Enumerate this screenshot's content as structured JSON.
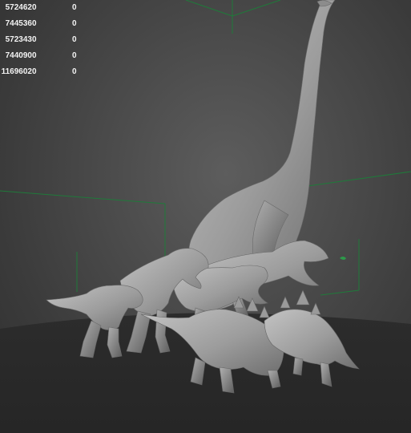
{
  "viewport": {
    "label": "3D perspective viewport",
    "stats": [
      [
        "572462",
        "0",
        "0"
      ],
      [
        "744536",
        "0",
        "0"
      ],
      [
        "572343",
        "0",
        "0"
      ],
      [
        "744090",
        "0",
        "0"
      ],
      [
        "1169602",
        "0",
        "0"
      ]
    ]
  },
  "scene": {
    "models": [
      {
        "name": "brachiosaurus-model"
      },
      {
        "name": "tyrannosaurus-model"
      },
      {
        "name": "carnotaurus-model"
      },
      {
        "name": "raptor-model"
      },
      {
        "name": "stegosaurus-model"
      }
    ]
  },
  "colors": {
    "background": "#4c4c4c",
    "floor": "#2a2a2a",
    "grid_lines": "#1f7a3a",
    "sculpt": "#a8a8a8",
    "stats_text": "#f2f2f2"
  }
}
